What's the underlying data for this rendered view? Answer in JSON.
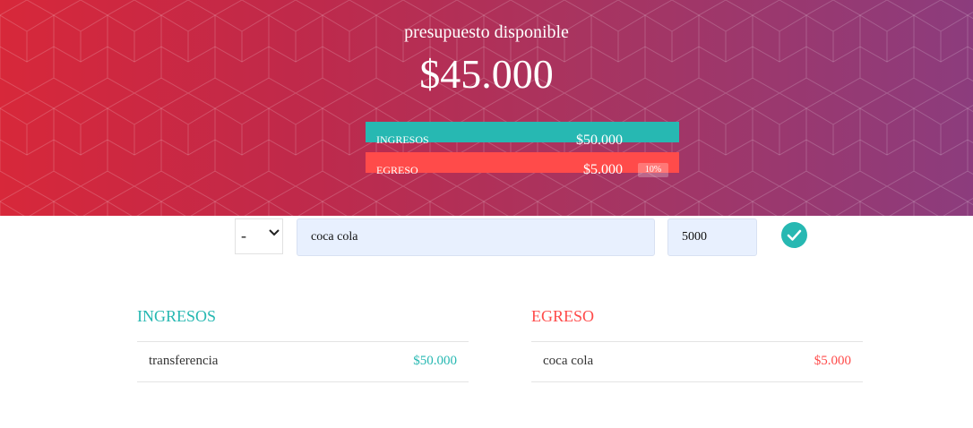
{
  "header": {
    "title": "presupuesto disponible",
    "amount": "$45.000"
  },
  "summary": {
    "income": {
      "label": "INGRESOS",
      "value": "$50.000",
      "color": "#27b8b2"
    },
    "expense": {
      "label": "EGRESO",
      "value": "$5.000",
      "percent": "10%",
      "color": "#ff4b4a"
    }
  },
  "add_form": {
    "type_selected": "-",
    "description_value": "coca cola",
    "amount_value": "5000",
    "submit_icon": "check-icon"
  },
  "lists": {
    "income": {
      "title": "INGRESOS",
      "items": [
        {
          "description": "transferencia",
          "value": "$50.000"
        }
      ]
    },
    "expense": {
      "title": "EGRESO",
      "items": [
        {
          "description": "coca cola",
          "value": "$5.000"
        }
      ]
    }
  }
}
